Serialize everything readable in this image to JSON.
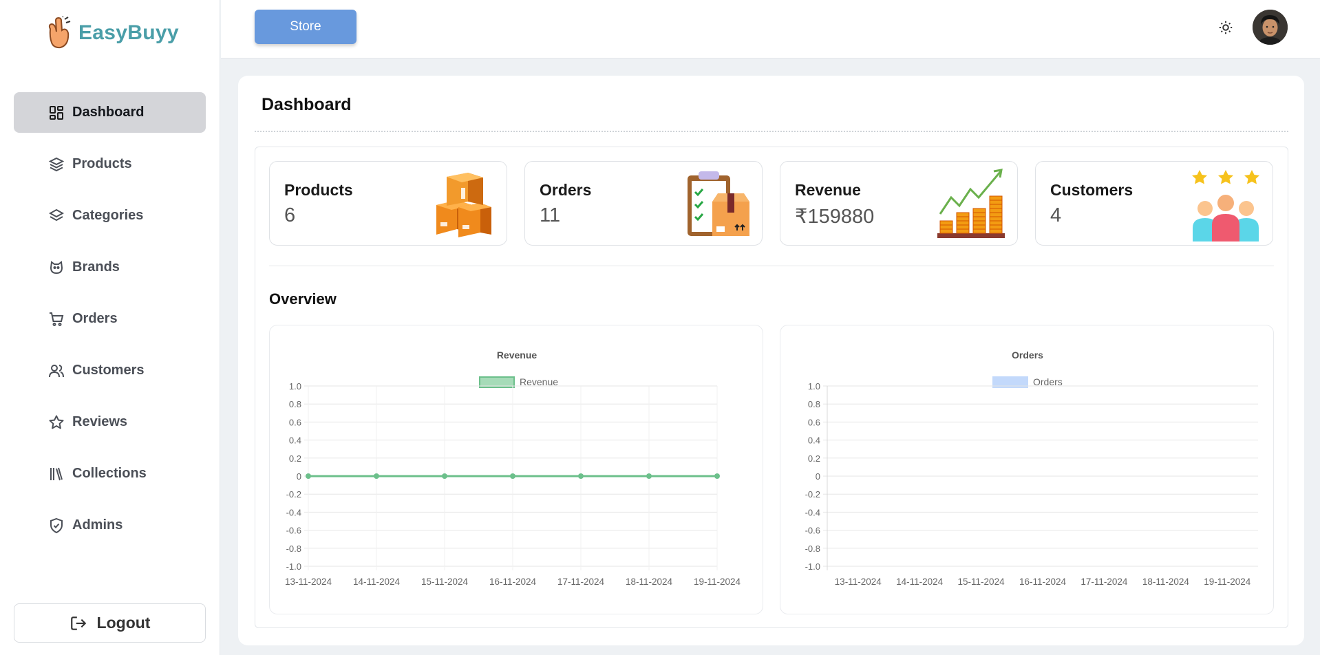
{
  "brand": {
    "name": "EasyBuyy"
  },
  "sidebar": {
    "items": [
      {
        "label": "Dashboard",
        "icon": "dashboard-icon",
        "active": true
      },
      {
        "label": "Products",
        "icon": "box-icon"
      },
      {
        "label": "Categories",
        "icon": "layers-icon"
      },
      {
        "label": "Brands",
        "icon": "badge-icon"
      },
      {
        "label": "Orders",
        "icon": "cart-icon"
      },
      {
        "label": "Customers",
        "icon": "users-icon"
      },
      {
        "label": "Reviews",
        "icon": "star-icon"
      },
      {
        "label": "Collections",
        "icon": "library-icon"
      },
      {
        "label": "Admins",
        "icon": "shield-icon"
      }
    ],
    "logout_label": "Logout"
  },
  "topbar": {
    "store_label": "Store"
  },
  "page": {
    "title": "Dashboard",
    "overview_title": "Overview"
  },
  "stats": [
    {
      "title": "Products",
      "value": "6",
      "icon": "boxes-illustration"
    },
    {
      "title": "Orders",
      "value": "11",
      "icon": "clipboard-package-illustration"
    },
    {
      "title": "Revenue",
      "value": "₹159880",
      "icon": "coins-growth-illustration"
    },
    {
      "title": "Customers",
      "value": "4",
      "icon": "customers-stars-illustration"
    }
  ],
  "colors": {
    "accent": "#4a9ea8",
    "store_button": "#6899dd",
    "revenue_line": "#6cc08b",
    "orders_legend": "#c3d9fb"
  },
  "chart_data": [
    {
      "type": "line",
      "title": "Revenue",
      "categories": [
        "13-11-2024",
        "14-11-2024",
        "15-11-2024",
        "16-11-2024",
        "17-11-2024",
        "18-11-2024",
        "19-11-2024"
      ],
      "series": [
        {
          "name": "Revenue",
          "values": [
            0,
            0,
            0,
            0,
            0,
            0,
            0
          ]
        }
      ],
      "yticks": [
        "1.0",
        "0.8",
        "0.6",
        "0.4",
        "0.2",
        "0",
        "-0.2",
        "-0.4",
        "-0.6",
        "-0.8",
        "-1.0"
      ],
      "ylim": [
        -1,
        1
      ],
      "grid": true,
      "legend": "top-center"
    },
    {
      "type": "bar",
      "title": "Orders",
      "categories": [
        "13-11-2024",
        "14-11-2024",
        "15-11-2024",
        "16-11-2024",
        "17-11-2024",
        "18-11-2024",
        "19-11-2024"
      ],
      "series": [
        {
          "name": "Orders",
          "values": [
            0,
            0,
            0,
            0,
            0,
            0,
            0
          ]
        }
      ],
      "yticks": [
        "1.0",
        "0.8",
        "0.6",
        "0.4",
        "0.2",
        "0",
        "-0.2",
        "-0.4",
        "-0.6",
        "-0.8",
        "-1.0"
      ],
      "ylim": [
        -1,
        1
      ],
      "grid": true,
      "legend": "top-center"
    }
  ]
}
